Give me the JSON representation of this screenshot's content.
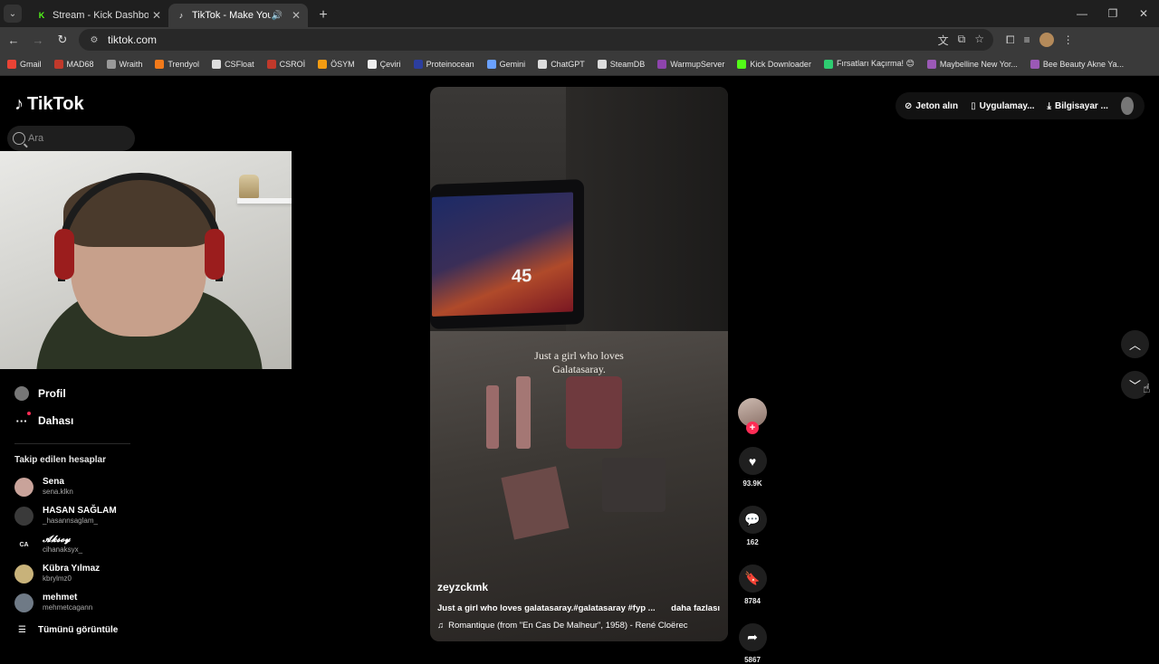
{
  "browser": {
    "tabs": [
      {
        "title": "Stream - Kick Dashboard",
        "favicon": "K",
        "favicon_color": "#53fc18"
      },
      {
        "title": "TikTok - Make Your Day",
        "favicon": "♪",
        "favicon_color": "#ffffff"
      }
    ],
    "url": "tiktok.com",
    "bookmarks": [
      {
        "label": "Gmail",
        "color": "#ea4335"
      },
      {
        "label": "MAD68",
        "color": "#c0392b"
      },
      {
        "label": "Wraith",
        "color": "#999999"
      },
      {
        "label": "Trendyol",
        "color": "#f27a1a"
      },
      {
        "label": "CSFloat",
        "color": "#dddddd"
      },
      {
        "label": "CSROİ",
        "color": "#c0392b"
      },
      {
        "label": "ÖSYM",
        "color": "#f39c12"
      },
      {
        "label": "Çeviri",
        "color": "#eeeeee"
      },
      {
        "label": "Proteinocean",
        "color": "#2c3e9e"
      },
      {
        "label": "Gemini",
        "color": "#6aa1ff"
      },
      {
        "label": "ChatGPT",
        "color": "#dddddd"
      },
      {
        "label": "SteamDB",
        "color": "#dddddd"
      },
      {
        "label": "WarmupServer",
        "color": "#8e44ad"
      },
      {
        "label": "Kick Downloader",
        "color": "#53fc18"
      },
      {
        "label": "Fırsatları Kaçırma! 😊",
        "color": "#2ecc71"
      },
      {
        "label": "Maybelline New Yor...",
        "color": "#9b59b6"
      },
      {
        "label": "Bee Beauty Akne Ya...",
        "color": "#9b59b6"
      }
    ]
  },
  "sidebar": {
    "logo": "TikTok",
    "search_placeholder": "Ara",
    "profile": "Profil",
    "more": "Dahası",
    "following_title": "Takip edilen hesaplar",
    "following": [
      {
        "name": "Sena",
        "username": "sena.klkn",
        "initials": ""
      },
      {
        "name": "HASAN SAĞLAM",
        "username": "_hasannsaglam_",
        "initials": ""
      },
      {
        "name": "𝓐𝓴𝓼𝓸𝔂",
        "username": "cihanaksyx_",
        "initials": "CA"
      },
      {
        "name": "Kübra Yılmaz",
        "username": "kbrylmz0",
        "initials": ""
      },
      {
        "name": "mehmet",
        "username": "mehmetcagann",
        "initials": ""
      }
    ],
    "see_all": "Tümünü görüntüle"
  },
  "video": {
    "overlay_text": "Just a girl who loves\nGalatasaray.",
    "jersey_number": "45",
    "author": "zeyzckmk",
    "description": "Just a girl who loves galatasaray.#galatasaray #fyp ...",
    "more_label": "daha fazlası",
    "music": "Romantique (from \"En Cas De Malheur\", 1958) - René Cloërec"
  },
  "actions": {
    "likes": "93.9K",
    "comments": "162",
    "saves": "8784",
    "shares": "5867"
  },
  "topbar": {
    "coins": "Jeton alın",
    "app": "Uygulamay...",
    "desktop": "Bilgisayar ..."
  }
}
